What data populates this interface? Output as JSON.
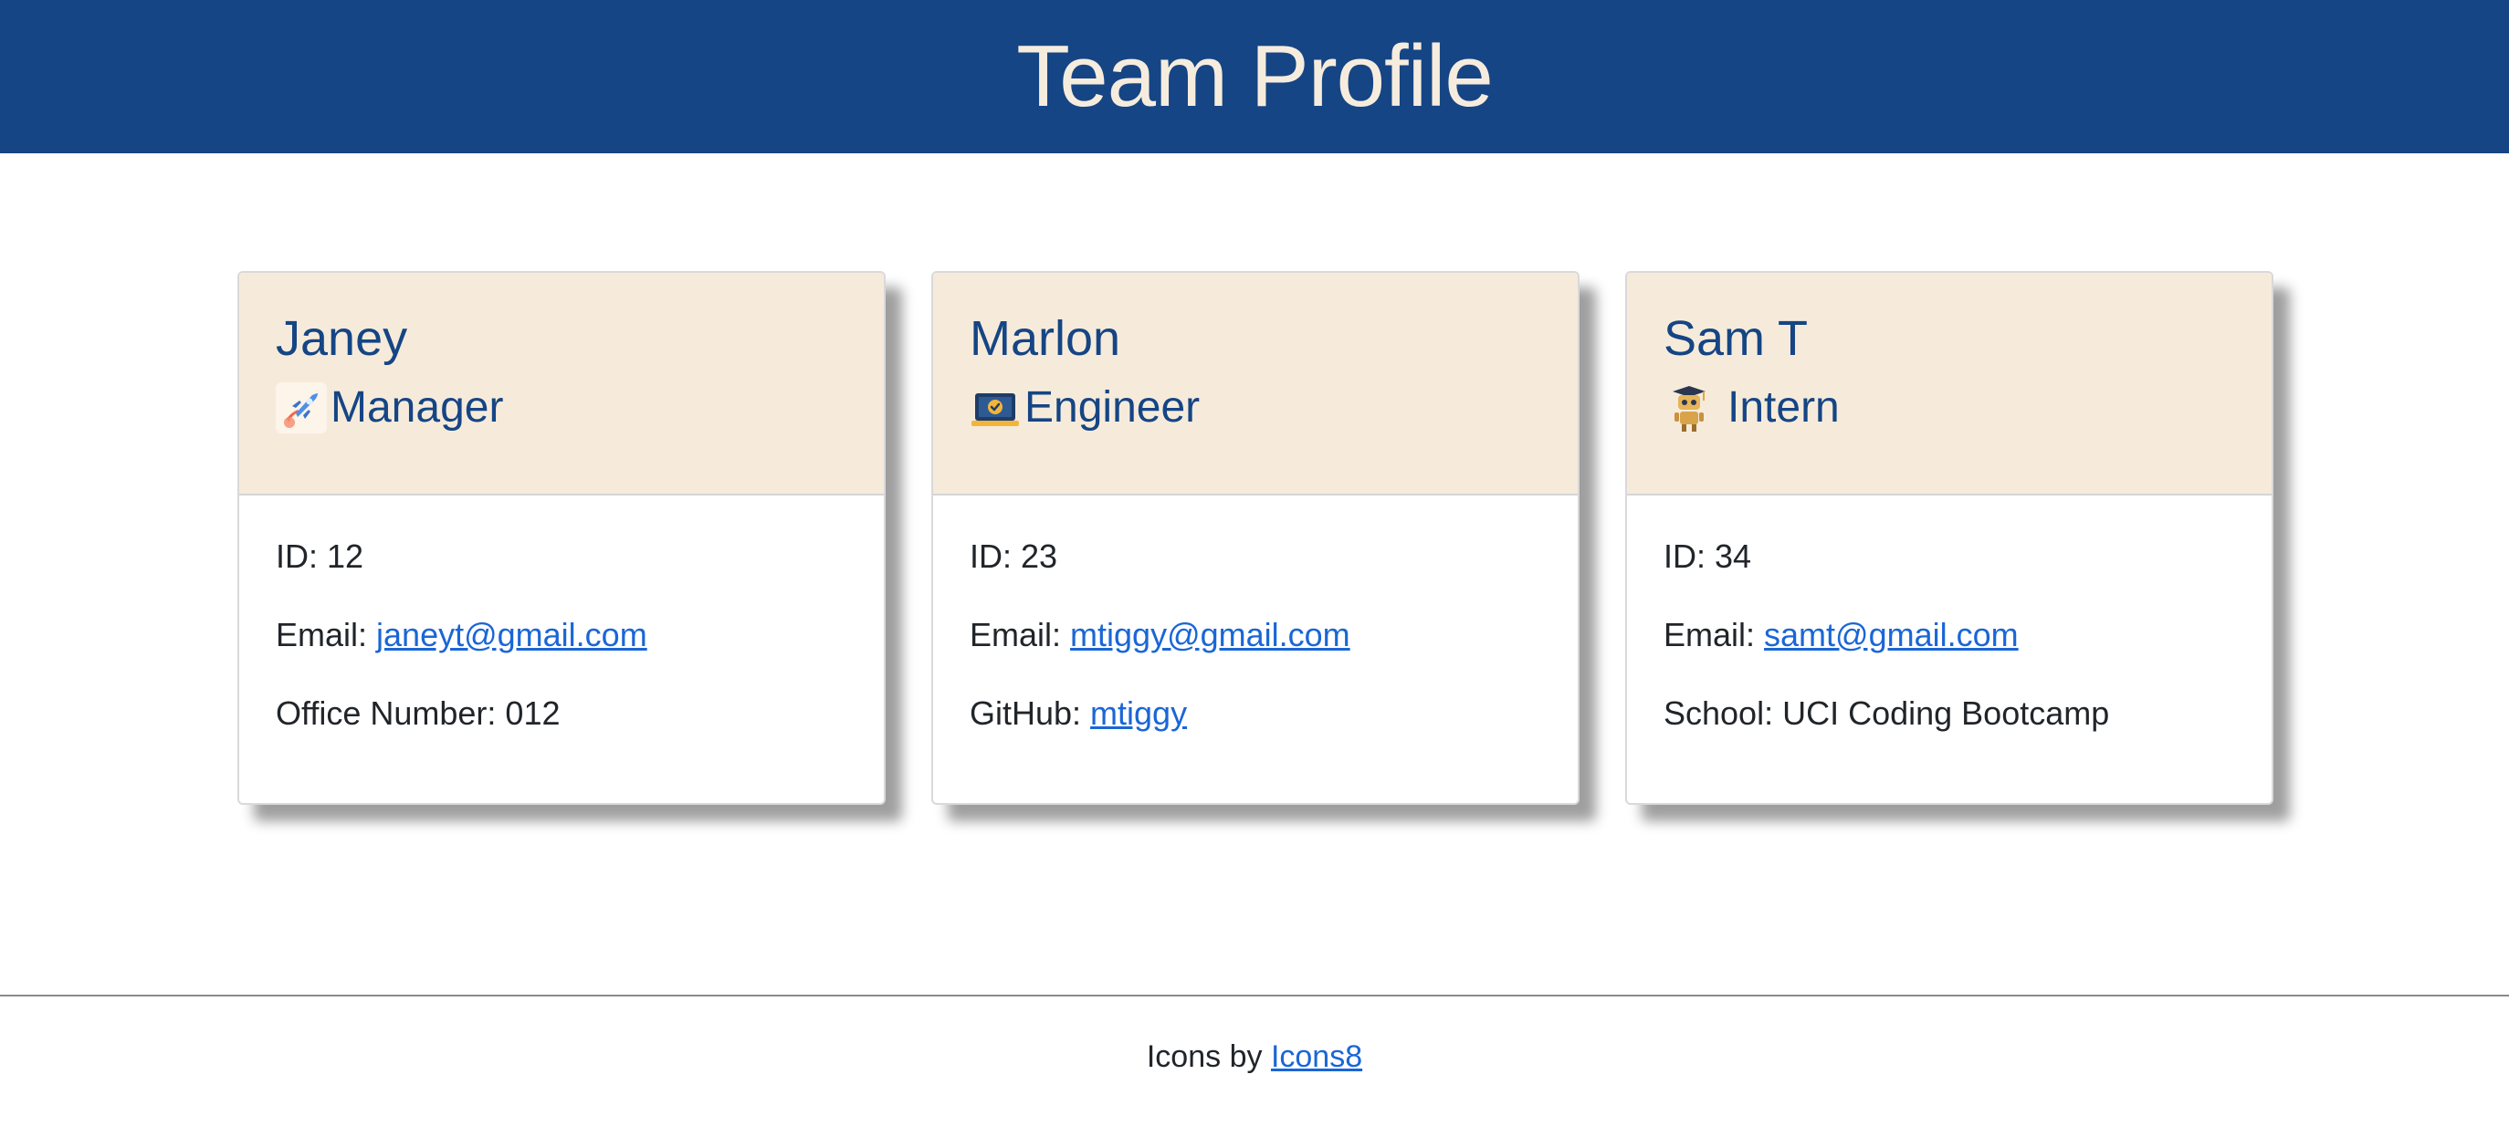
{
  "header": {
    "title": "Team Profile"
  },
  "cards": [
    {
      "name": "Janey",
      "role": "Manager",
      "icon": "rocket-icon",
      "id_label": "ID: ",
      "id": "12",
      "email_label": "Email: ",
      "email": "janeyt@gmail.com",
      "extra_label": "Office Number: ",
      "extra_value": "012"
    },
    {
      "name": "Marlon",
      "role": "Engineer",
      "icon": "laptop-check-icon",
      "id_label": "ID: ",
      "id": "23",
      "email_label": "Email: ",
      "email": "mtiggy@gmail.com",
      "extra_label": "GitHub: ",
      "extra_value": "mtiggy"
    },
    {
      "name": "Sam T",
      "role": "Intern",
      "icon": "graduate-robot-icon",
      "id_label": "ID: ",
      "id": "34",
      "email_label": "Email: ",
      "email": "samt@gmail.com",
      "extra_label": "School: ",
      "extra_value": "UCI Coding Bootcamp"
    }
  ],
  "footer": {
    "prefix": "Icons by ",
    "link": "Icons8"
  },
  "colors": {
    "header_bg": "#154584",
    "header_text": "#f6ecde",
    "card_head_bg": "#f6ebdb",
    "link": "#1a66d6"
  }
}
